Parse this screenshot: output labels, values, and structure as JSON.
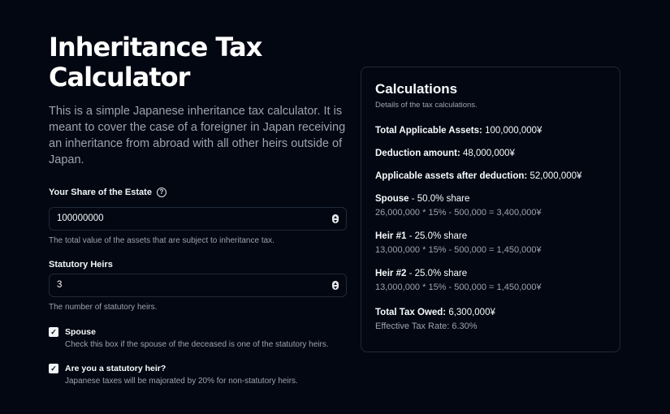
{
  "header": {
    "title": "Inheritance Tax Calculator",
    "intro": "This is a simple Japanese inheritance tax calculator. It is meant to cover the case of a foreigner in Japan receiving an inheritance from abroad with all other heirs outside of Japan."
  },
  "form": {
    "share": {
      "label": "Your Share of the Estate",
      "value": "100000000",
      "description": "The total value of the assets that are subject to inheritance tax."
    },
    "heirs": {
      "label": "Statutory Heirs",
      "value": "3",
      "description": "The number of statutory heirs."
    },
    "spouse": {
      "label": "Spouse",
      "checked": true,
      "description": "Check this box if the spouse of the deceased is one of the statutory heirs."
    },
    "statutory_heir": {
      "label": "Are you a statutory heir?",
      "checked": true,
      "description": "Japanese taxes will be majorated by 20% for non-statutory heirs."
    }
  },
  "calculations": {
    "title": "Calculations",
    "subtitle": "Details of the tax calculations.",
    "total_assets": {
      "label": "Total Applicable Assets:",
      "value": "100,000,000¥"
    },
    "deduction": {
      "label": "Deduction amount:",
      "value": "48,000,000¥"
    },
    "after_deduction": {
      "label": "Applicable assets after deduction:",
      "value": "52,000,000¥"
    },
    "heirs": [
      {
        "name": "Spouse",
        "share": "- 50.0% share",
        "formula": "26,000,000 * 15% - 500,000 = 3,400,000¥"
      },
      {
        "name": "Heir #1",
        "share": "- 25.0% share",
        "formula": "13,000,000 * 15% - 500,000 = 1,450,000¥"
      },
      {
        "name": "Heir #2",
        "share": "- 25.0% share",
        "formula": "13,000,000 * 15% - 500,000 = 1,450,000¥"
      }
    ],
    "total_owed": {
      "label": "Total Tax Owed:",
      "value": "6,300,000¥"
    },
    "effective_rate": "Effective Tax Rate: 6.30%"
  }
}
